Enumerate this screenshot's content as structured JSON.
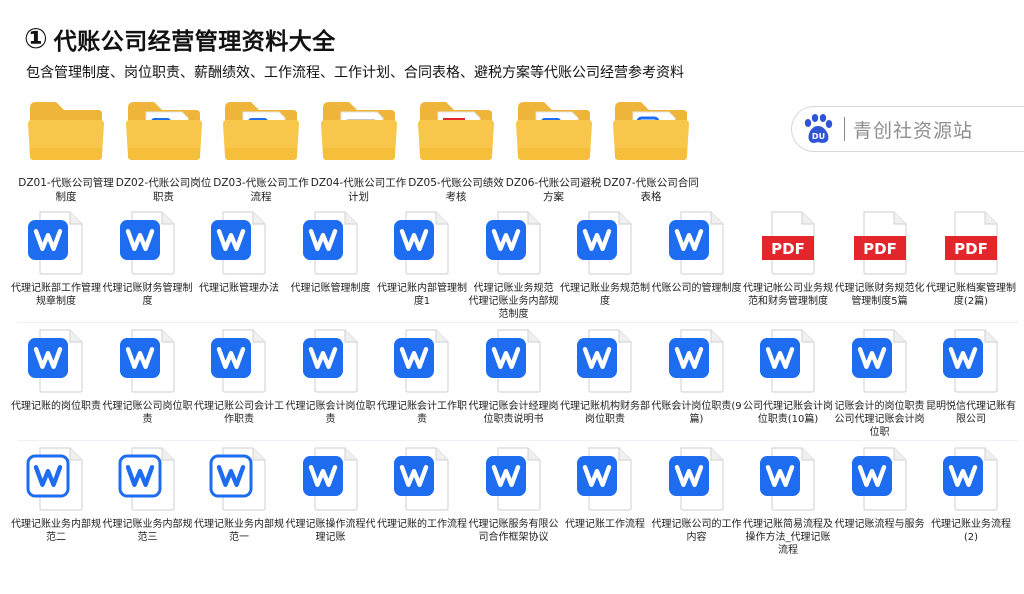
{
  "header": {
    "number": "①",
    "title": "代账公司经营管理资料大全",
    "subtitle": "包含管理制度、岗位职责、薪酬绩效、工作流程、工作计划、合同表格、避税方案等代账公司经营参考资料"
  },
  "watermark": {
    "badge": "DU",
    "text": "青创社资源站"
  },
  "colors": {
    "word_blue": "#1e6df0",
    "pdf_red": "#e3262b",
    "folder_yellow": "#f8c64a"
  },
  "folders": [
    {
      "label": "DZ01-代账公司管理制度",
      "content": "none"
    },
    {
      "label": "DZ02-代账公司岗位职责",
      "content": "word"
    },
    {
      "label": "DZ03-代账公司工作流程",
      "content": "word"
    },
    {
      "label": "DZ04-代账公司工作计划",
      "content": "doc"
    },
    {
      "label": "DZ05-代账公司绩效考核",
      "content": "pdf"
    },
    {
      "label": "DZ06-代账公司避税方案",
      "content": "word"
    },
    {
      "label": "DZ07-代账公司合同表格",
      "content": "word-outline"
    }
  ],
  "files": [
    [
      {
        "label": "代理记账部工作管理规章制度",
        "type": "word"
      },
      {
        "label": "代理记账财务管理制度",
        "type": "word"
      },
      {
        "label": "代理记账管理办法",
        "type": "word"
      },
      {
        "label": "代理记账管理制度",
        "type": "word"
      },
      {
        "label": "代理记账内部管理制度1",
        "type": "word"
      },
      {
        "label": "代理记账业务规范 代理记账业务内部规范制度",
        "type": "word"
      },
      {
        "label": "代理记账业务规范制度",
        "type": "word"
      },
      {
        "label": "代账公司的管理制度",
        "type": "word"
      },
      {
        "label": "代理记帐公司业务规范和财务管理制度",
        "type": "pdf",
        "badge": "PDF"
      },
      {
        "label": "代理记账财务规范化管理制度5篇",
        "type": "pdf",
        "badge": "PDF"
      },
      {
        "label": "代理记账档案管理制度(2篇)",
        "type": "pdf",
        "badge": "PDF"
      }
    ],
    [
      {
        "label": "代理记账的岗位职责",
        "type": "word"
      },
      {
        "label": "代理记账公司岗位职责",
        "type": "word"
      },
      {
        "label": "代理记账公司会计工作职责",
        "type": "word"
      },
      {
        "label": "代理记账会计岗位职责",
        "type": "word"
      },
      {
        "label": "代理记账会计工作职责",
        "type": "word"
      },
      {
        "label": "代理记账会计经理岗位职责说明书",
        "type": "word"
      },
      {
        "label": "代理记账机构财务部岗位职责",
        "type": "word"
      },
      {
        "label": "代账会计岗位职责(9篇)",
        "type": "word"
      },
      {
        "label": "公司代理记账会计岗位职责(10篇)",
        "type": "word"
      },
      {
        "label": "记账会计的岗位职责公司代理记账会计岗位职",
        "type": "word"
      },
      {
        "label": "昆明悦信代理记账有限公司",
        "type": "word"
      }
    ],
    [
      {
        "label": "代理记账业务内部规范二",
        "type": "word-outline"
      },
      {
        "label": "代理记账业务内部规范三",
        "type": "word-outline"
      },
      {
        "label": "代理记账业务内部规范一",
        "type": "word-outline"
      },
      {
        "label": "代理记账操作流程代理记账",
        "type": "word"
      },
      {
        "label": "代理记账的工作流程",
        "type": "word"
      },
      {
        "label": "代理记账服务有限公司合作框架协议",
        "type": "word"
      },
      {
        "label": "代理记账工作流程",
        "type": "word"
      },
      {
        "label": "代理记账公司的工作内容",
        "type": "word"
      },
      {
        "label": "代理记账简易流程及操作方法_代理记账流程",
        "type": "word"
      },
      {
        "label": "代理记账流程与服务",
        "type": "word"
      },
      {
        "label": "代理记账业务流程 (2)",
        "type": "word"
      }
    ]
  ]
}
